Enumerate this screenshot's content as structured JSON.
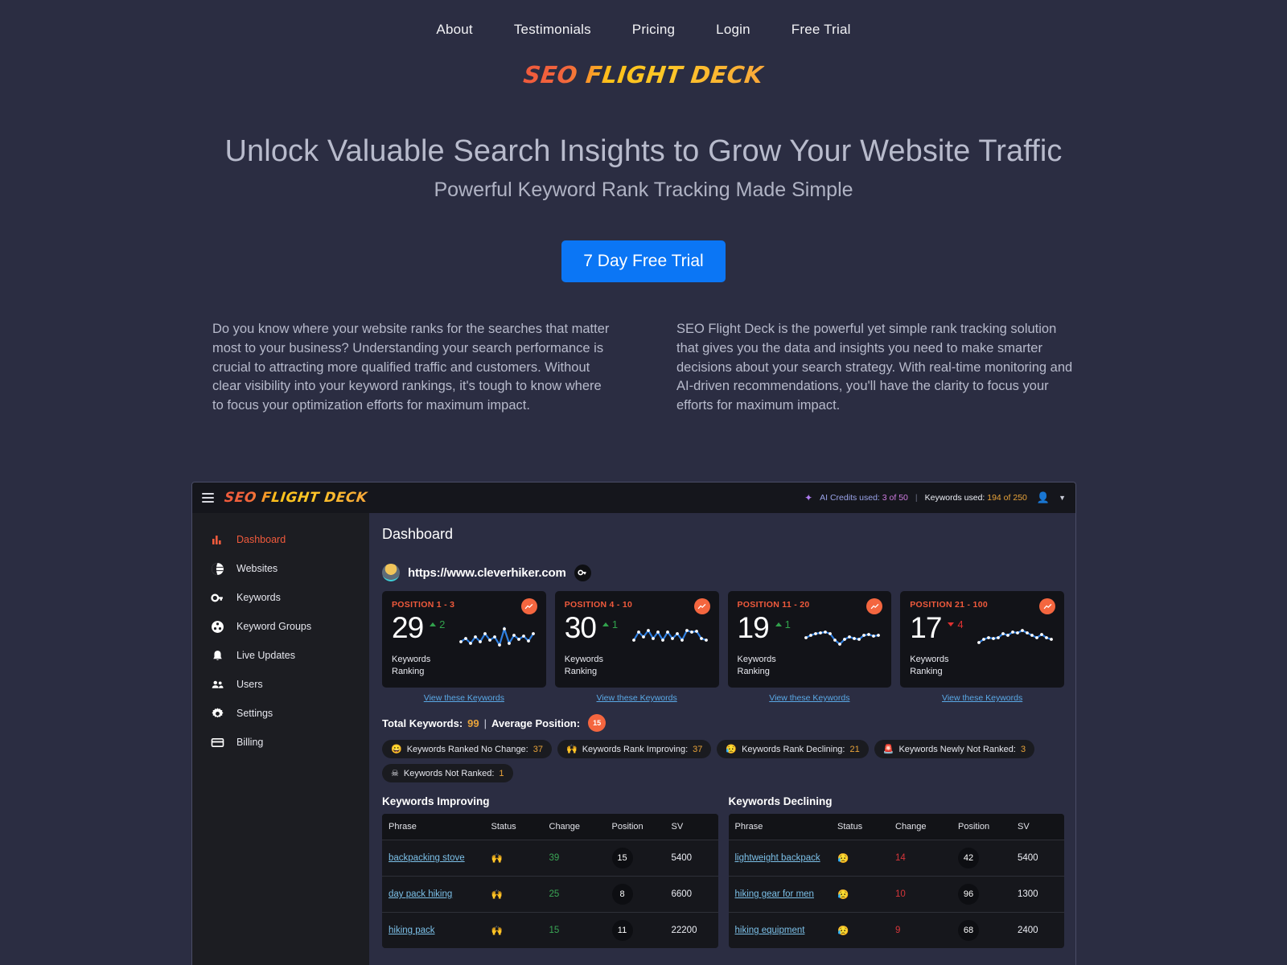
{
  "nav": {
    "items": [
      {
        "label": "About"
      },
      {
        "label": "Testimonials"
      },
      {
        "label": "Pricing"
      },
      {
        "label": "Login"
      },
      {
        "label": "Free Trial"
      }
    ]
  },
  "brand": {
    "part1": "SEO ",
    "part2": "FLIGHT DECK",
    "full": "SEO FLIGHT DECK"
  },
  "hero": {
    "headline": "Unlock Valuable Search Insights to Grow Your Website Traffic",
    "subhead": "Powerful Keyword Rank Tracking Made Simple",
    "cta_label": "7 Day Free Trial"
  },
  "copy": {
    "left": "Do you know where your website ranks for the searches that matter most to your business? Understanding your search performance is crucial to attracting more qualified traffic and customers. Without clear visibility into your keyword rankings, it's tough to know where to focus your optimization efforts for maximum impact.",
    "right": "SEO Flight Deck is the powerful yet simple rank tracking solution that gives you the data and insights you need to make smarter decisions about your search strategy. With real-time monitoring and AI-driven recommendations, you'll have the clarity to focus your efforts for maximum impact."
  },
  "app": {
    "appbar": {
      "brand1": "SEO ",
      "brand2": "FLIGHT DECK",
      "ai_credits_label": "AI Credits used: ",
      "ai_credits_value": "3 of 50",
      "separator": "|",
      "keywords_label": "Keywords used: ",
      "keywords_value": "194 of 250"
    },
    "sidebar": {
      "items": [
        {
          "label": "Dashboard",
          "icon": "bar-chart-icon",
          "active": true
        },
        {
          "label": "Websites",
          "icon": "globe-icon",
          "active": false
        },
        {
          "label": "Keywords",
          "icon": "key-icon",
          "active": false
        },
        {
          "label": "Keyword Groups",
          "icon": "group-icon",
          "active": false
        },
        {
          "label": "Live Updates",
          "icon": "bell-icon",
          "active": false
        },
        {
          "label": "Users",
          "icon": "users-icon",
          "active": false
        },
        {
          "label": "Settings",
          "icon": "gear-icon",
          "active": false
        },
        {
          "label": "Billing",
          "icon": "credit-card-icon",
          "active": false
        }
      ]
    },
    "page_title": "Dashboard",
    "site": {
      "url": "https://www.cleverhiker.com"
    },
    "cards": [
      {
        "title": "POSITION 1 - 3",
        "value": "29",
        "delta": "2",
        "dir": "up",
        "sub_line1": "Keywords",
        "sub_line2": "Ranking",
        "spark": [
          8,
          11,
          6,
          12,
          8,
          14,
          9,
          11,
          4,
          16,
          7,
          13,
          10,
          12,
          9,
          7
        ]
      },
      {
        "title": "POSITION 4 - 10",
        "value": "30",
        "delta": "1",
        "dir": "up",
        "sub_line1": "Keywords",
        "sub_line2": "Ranking",
        "spark": [
          14,
          8,
          12,
          6,
          13,
          7,
          12,
          6,
          11,
          9,
          13,
          5,
          12,
          9,
          11,
          13
        ]
      },
      {
        "title": "POSITION 11 - 20",
        "value": "19",
        "delta": "1",
        "dir": "up",
        "sub_line1": "Keywords",
        "sub_line2": "Ranking",
        "spark": [
          6,
          8,
          9,
          10,
          11,
          9,
          5,
          3,
          7,
          9,
          8,
          7,
          10,
          11,
          9,
          10
        ]
      },
      {
        "title": "POSITION 21 - 100",
        "value": "17",
        "delta": "4",
        "dir": "down",
        "sub_line1": "Keywords",
        "sub_line2": "Ranking",
        "spark": [
          5,
          7,
          9,
          8,
          9,
          12,
          11,
          13,
          12,
          14,
          12,
          10,
          9,
          11,
          9,
          8
        ]
      }
    ],
    "view_link_label": "View these Keywords",
    "totals": {
      "total_label": "Total Keywords:",
      "total_value": "99",
      "pipe": "|",
      "avg_label": "Average Position:",
      "avg_value": "15"
    },
    "badges": [
      {
        "emoji": "😀",
        "label": "Keywords Ranked No Change:",
        "value": "37"
      },
      {
        "emoji": "🙌",
        "label": "Keywords Rank Improving:",
        "value": "37"
      },
      {
        "emoji": "😥",
        "label": "Keywords Rank Declining:",
        "value": "21"
      },
      {
        "emoji": "🚨",
        "label": "Keywords Newly Not Ranked:",
        "value": "3"
      },
      {
        "emoji": "☠",
        "label": "Keywords Not Ranked:",
        "value": "1"
      }
    ],
    "tables": {
      "improving": {
        "title": "Keywords Improving",
        "columns": [
          "Phrase",
          "Status",
          "Change",
          "Position",
          "SV"
        ],
        "rows": [
          {
            "phrase": "backpacking stove",
            "emoji": "🙌",
            "change": "39",
            "position": "15",
            "sv": "5400"
          },
          {
            "phrase": "day pack hiking",
            "emoji": "🙌",
            "change": "25",
            "position": "8",
            "sv": "6600"
          },
          {
            "phrase": "hiking pack",
            "emoji": "🙌",
            "change": "15",
            "position": "11",
            "sv": "22200"
          }
        ]
      },
      "declining": {
        "title": "Keywords Declining",
        "columns": [
          "Phrase",
          "Status",
          "Change",
          "Position",
          "SV"
        ],
        "rows": [
          {
            "phrase": "lightweight backpack",
            "emoji": "😥",
            "change": "14",
            "position": "42",
            "sv": "5400"
          },
          {
            "phrase": "hiking gear for men",
            "emoji": "😥",
            "change": "10",
            "position": "96",
            "sv": "1300"
          },
          {
            "phrase": "hiking equipment",
            "emoji": "😥",
            "change": "9",
            "position": "68",
            "sv": "2400"
          }
        ]
      }
    }
  }
}
